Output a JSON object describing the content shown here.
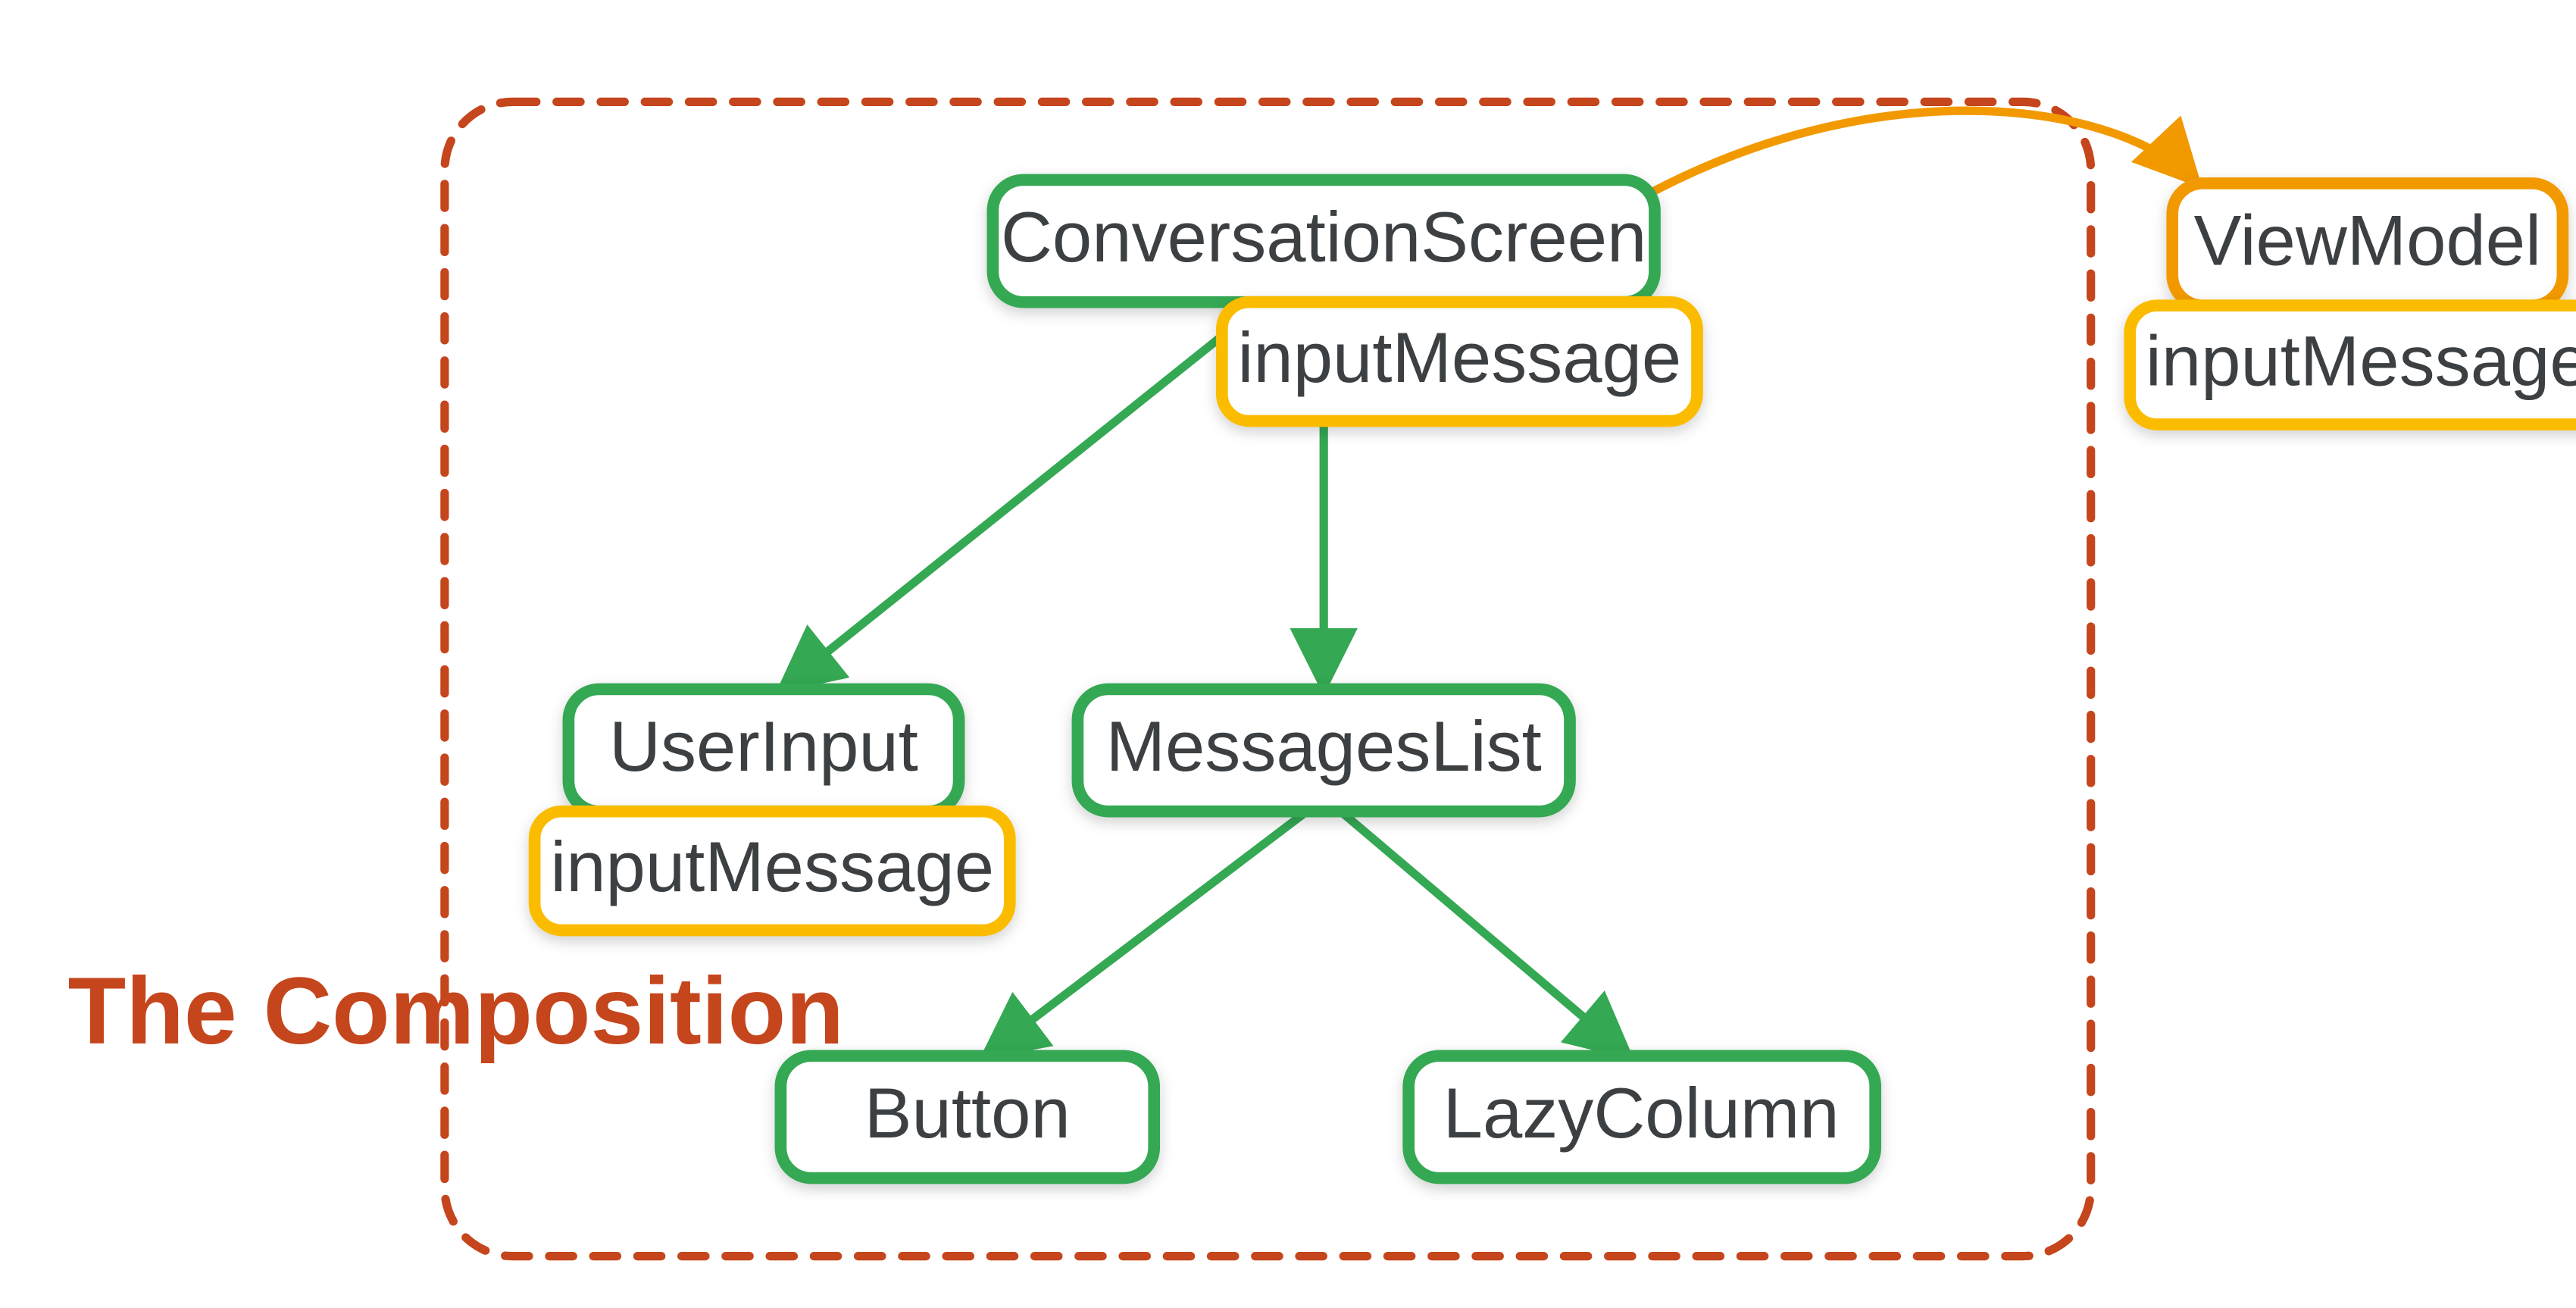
{
  "title": "The Composition",
  "colors": {
    "green": "#34a853",
    "yellow": "#fbbc04",
    "orange": "#f29900",
    "rust": "#c5451c",
    "text": "#3c4043"
  },
  "nodes": {
    "conversationScreen": {
      "label": "ConversationScreen",
      "attached": "inputMessage"
    },
    "userInput": {
      "label": "UserInput",
      "attached": "inputMessage"
    },
    "messagesList": {
      "label": "MessagesList"
    },
    "button": {
      "label": "Button"
    },
    "lazyColumn": {
      "label": "LazyColumn"
    },
    "viewModel": {
      "label": "ViewModel",
      "attached": "inputMessage"
    }
  },
  "edges": [
    {
      "from": "conversationScreen",
      "to": "userInput",
      "color": "green"
    },
    {
      "from": "conversationScreen",
      "to": "messagesList",
      "color": "green"
    },
    {
      "from": "messagesList",
      "to": "button",
      "color": "green"
    },
    {
      "from": "messagesList",
      "to": "lazyColumn",
      "color": "green"
    },
    {
      "from": "conversationScreen",
      "to": "viewModel",
      "color": "orange",
      "style": "curve"
    }
  ]
}
